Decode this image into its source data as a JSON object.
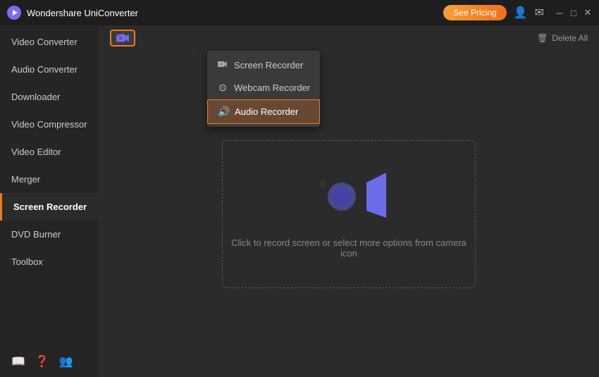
{
  "titleBar": {
    "appTitle": "Wondershare UniConverter",
    "seePricing": "See Pricing"
  },
  "sidebar": {
    "items": [
      {
        "id": "video-converter",
        "label": "Video Converter",
        "active": false
      },
      {
        "id": "audio-converter",
        "label": "Audio Converter",
        "active": false
      },
      {
        "id": "downloader",
        "label": "Downloader",
        "active": false
      },
      {
        "id": "video-compressor",
        "label": "Video Compressor",
        "active": false
      },
      {
        "id": "video-editor",
        "label": "Video Editor",
        "active": false
      },
      {
        "id": "merger",
        "label": "Merger",
        "active": false
      },
      {
        "id": "screen-recorder",
        "label": "Screen Recorder",
        "active": true
      },
      {
        "id": "dvd-burner",
        "label": "DVD Burner",
        "active": false
      },
      {
        "id": "toolbox",
        "label": "Toolbox",
        "active": false
      }
    ]
  },
  "header": {
    "deleteAll": "Delete All"
  },
  "dropdown": {
    "items": [
      {
        "id": "screen-recorder",
        "label": "Screen Recorder",
        "icon": "🎬",
        "active": false
      },
      {
        "id": "webcam-recorder",
        "label": "Webcam Recorder",
        "icon": "⊙",
        "active": false
      },
      {
        "id": "audio-recorder",
        "label": "Audio Recorder",
        "icon": "🔊",
        "active": true
      }
    ]
  },
  "recordArea": {
    "hint": "Click to record screen or select more options from camera icon"
  }
}
